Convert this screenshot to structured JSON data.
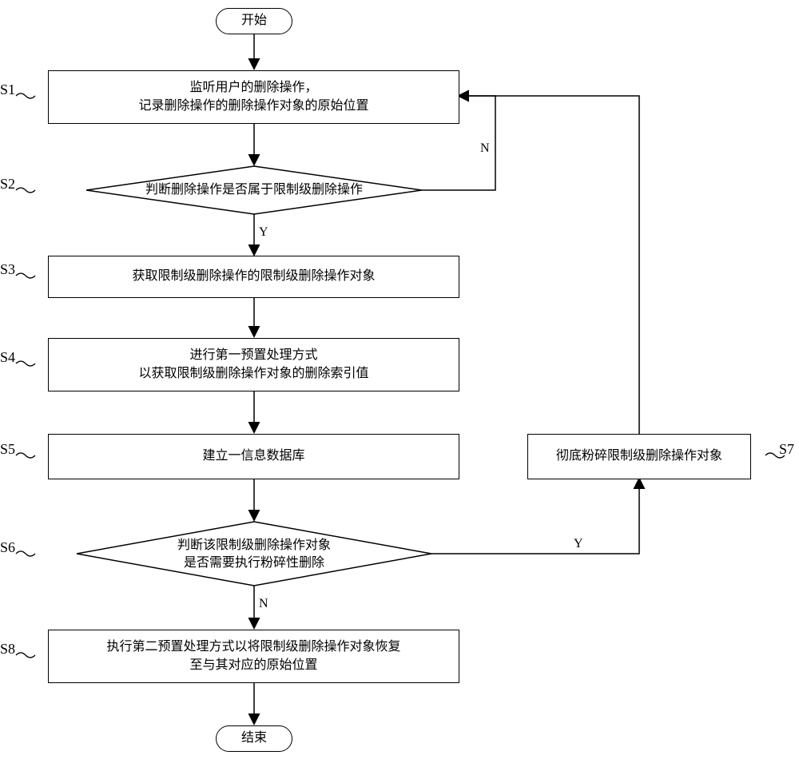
{
  "flowchart": {
    "start": "开始",
    "end": "结束",
    "s1": {
      "step": "S1",
      "line1": "监听用户的删除操作，",
      "line2": "记录删除操作的删除操作对象的原始位置"
    },
    "s2": {
      "step": "S2",
      "text": "判断删除操作是否属于限制级删除操作"
    },
    "s3": {
      "step": "S3",
      "text": "获取限制级删除操作的限制级删除操作对象"
    },
    "s4": {
      "step": "S4",
      "line1": "进行第一预置处理方式",
      "line2": "以获取限制级删除操作对象的删除索引值"
    },
    "s5": {
      "step": "S5",
      "text": "建立一信息数据库"
    },
    "s6": {
      "step": "S6",
      "line1": "判断该限制级删除操作对象",
      "line2": "是否需要执行粉碎性删除"
    },
    "s7": {
      "step": "S7",
      "text": "彻底粉碎限制级删除操作对象"
    },
    "s8": {
      "step": "S8",
      "line1": "执行第二预置处理方式以将限制级删除操作对象恢复",
      "line2": "至与其对应的原始位置"
    },
    "edges": {
      "yes": "Y",
      "no": "N"
    }
  }
}
